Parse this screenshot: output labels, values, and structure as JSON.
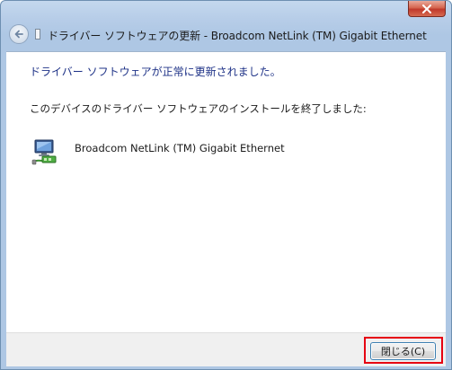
{
  "window": {
    "title": "ドライバー ソフトウェアの更新 - Broadcom NetLink (TM) Gigabit Ethernet"
  },
  "content": {
    "heading": "ドライバー ソフトウェアが正常に更新されました。",
    "message": "このデバイスのドライバー ソフトウェアのインストールを終了しました:",
    "device_name": "Broadcom NetLink (TM) Gigabit Ethernet",
    "device_icon": "network-adapter-icon"
  },
  "footer": {
    "close_label": "閉じる(C)"
  },
  "colors": {
    "heading": "#1e3287",
    "highlight": "#e60012",
    "titlebar": "#b7cde8"
  }
}
